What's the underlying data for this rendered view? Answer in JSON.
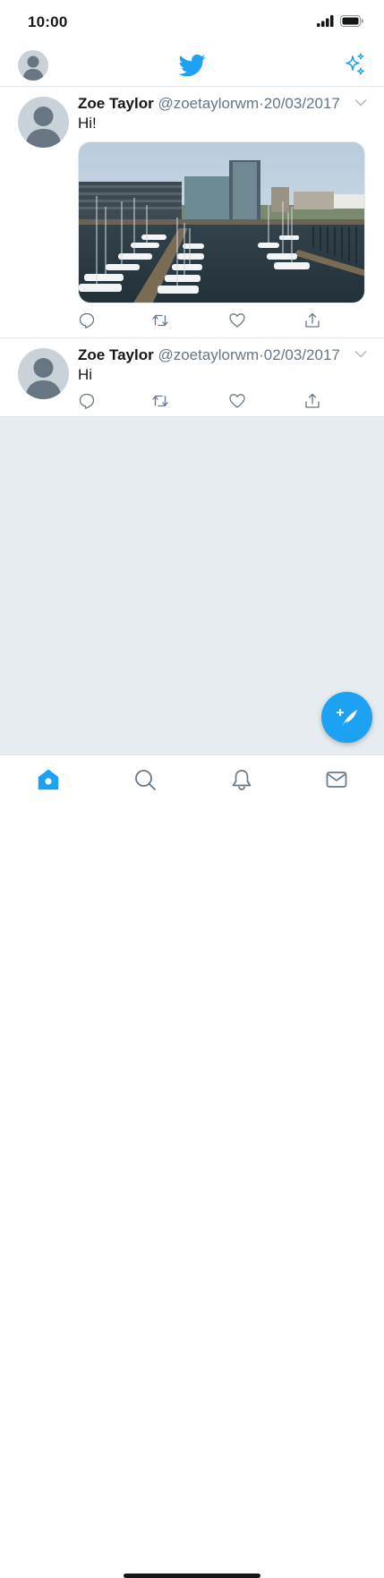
{
  "status_bar": {
    "time": "10:00"
  },
  "header": {
    "logo_icon": "twitter-bird-icon",
    "sparkle_icon": "sparkle-icon",
    "accent_color": "#1da1f2"
  },
  "tweets": [
    {
      "name": "Zoe Taylor",
      "handle": "@zoetaylorwm",
      "separator": "·",
      "date": "20/03/2017",
      "text": "Hi!",
      "has_media": true
    },
    {
      "name": "Zoe Taylor",
      "handle": "@zoetaylorwm",
      "separator": "·",
      "date": "02/03/2017",
      "text": "Hi",
      "has_media": false
    }
  ],
  "tab_bar": {
    "items": [
      "home-icon",
      "search-icon",
      "notifications-icon",
      "messages-icon"
    ],
    "active": "home-icon"
  },
  "compose": {
    "icon": "compose-feather-icon"
  }
}
